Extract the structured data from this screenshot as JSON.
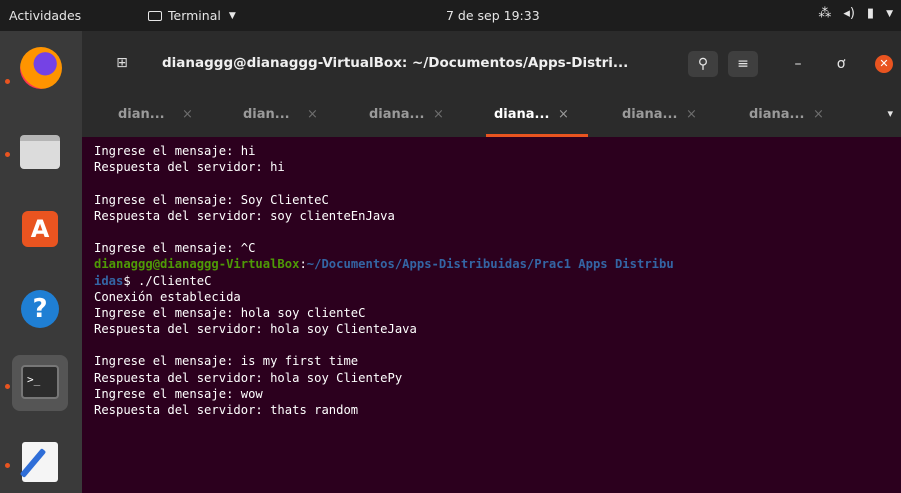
{
  "topbar": {
    "activities": "Actividades",
    "app_menu": "Terminal",
    "clock": "7 de sep  19:33",
    "tray_icons": [
      "network-icon",
      "volume-icon",
      "battery-icon",
      "chevron-down-icon"
    ]
  },
  "dock": {
    "items": [
      "firefox",
      "files",
      "software-store",
      "help",
      "terminal",
      "text-editor"
    ],
    "terminal_glyph": ">_"
  },
  "window": {
    "title": "dianaggg@dianaggg-VirtualBox: ~/Documentos/Apps-Distri...",
    "search_glyph": "⚲",
    "menu_glyph": "≡",
    "minimize_glyph": "–",
    "maximize_glyph": "ơ",
    "close_glyph": "✕",
    "newtab_glyph": "⊞"
  },
  "tabs": [
    {
      "label": "dian...",
      "active": false
    },
    {
      "label": "dian...",
      "active": false
    },
    {
      "label": "diana...",
      "active": false
    },
    {
      "label": "diana...",
      "active": true
    },
    {
      "label": "diana...",
      "active": false
    },
    {
      "label": "diana...",
      "active": false
    }
  ],
  "tab_close_glyph": "×",
  "tab_overflow_glyph": "▾",
  "terminal": {
    "lines": [
      "Ingrese el mensaje: hi",
      "Respuesta del servidor: hi",
      "",
      "Ingrese el mensaje: Soy ClienteC",
      "Respuesta del servidor: soy clienteEnJava",
      "",
      "Ingrese el mensaje: ^C"
    ],
    "prompt_user": "dianaggg@dianaggg-VirtualBox",
    "prompt_colon": ":",
    "prompt_path_1": "~/Documentos/Apps-Distribuidas/Prac1 Apps Distribu",
    "prompt_path_2": "idas",
    "prompt_symbol": "$ ",
    "command": "./ClienteC",
    "lines_after": [
      "Conexión establecida",
      "Ingrese el mensaje: hola soy clienteC",
      "Respuesta del servidor: hola soy ClienteJava",
      "",
      "Ingrese el mensaje: is my first time",
      "Respuesta del servidor: hola soy ClientePy",
      "Ingrese el mensaje: wow",
      "Respuesta del servidor: thats random"
    ]
  },
  "colors": {
    "accent": "#e95420",
    "terminal_bg": "#2c001e",
    "prompt_user": "#4e9a06",
    "prompt_path": "#3465a4"
  }
}
